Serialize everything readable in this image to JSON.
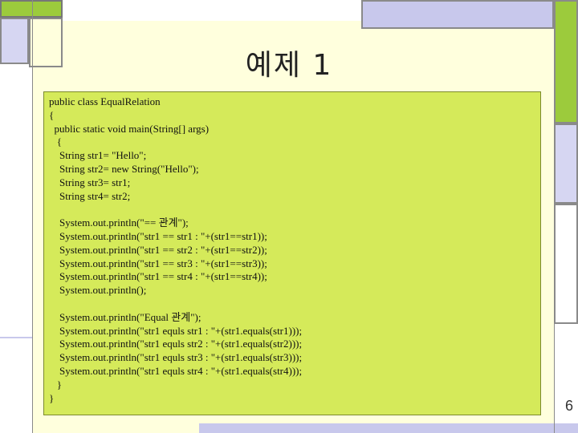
{
  "slide": {
    "title": "예제 1",
    "page_number": "6",
    "code_lines": [
      "public class EqualRelation",
      "{",
      "  public static void main(String[] args)",
      "   {",
      "    String str1= \"Hello\";",
      "    String str2= new String(\"Hello\");",
      "    String str3= str1;",
      "    String str4= str2;",
      "",
      "    System.out.println(\"== 관계\");",
      "    System.out.println(\"str1 == str1 : \"+(str1==str1));",
      "    System.out.println(\"str1 == str2 : \"+(str1==str2));",
      "    System.out.println(\"str1 == str3 : \"+(str1==str3));",
      "    System.out.println(\"str1 == str4 : \"+(str1==str4));",
      "    System.out.println();",
      "",
      "    System.out.println(\"Equal 관계\");",
      "    System.out.println(\"str1 equls str1 : \"+(str1.equals(str1)));",
      "    System.out.println(\"str1 equls str2 : \"+(str1.equals(str2)));",
      "    System.out.println(\"str1 equls str3 : \"+(str1.equals(str3)));",
      "    System.out.println(\"str1 equls str4 : \"+(str1.equals(str4)));",
      "   }",
      "}"
    ]
  },
  "colors": {
    "background": "#ffffdd",
    "code_box": "#d5ea5a",
    "accent_green": "#9ccb3c",
    "accent_lavender": "#c8c8ec",
    "border_gray": "#8a8a8a"
  }
}
